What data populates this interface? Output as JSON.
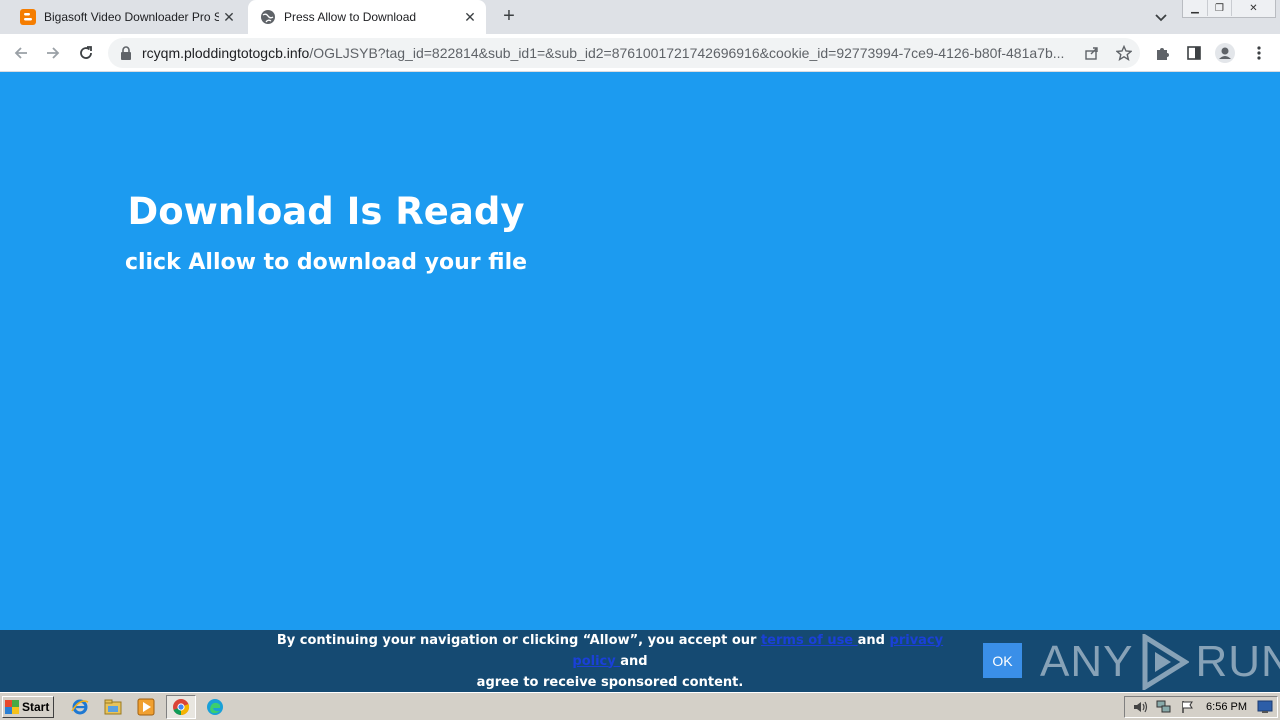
{
  "browser": {
    "tabs": [
      {
        "title": "Bigasoft Video Downloader Pro Serial",
        "favicon": "blogger-icon",
        "active": false
      },
      {
        "title": "Press Allow to Download",
        "favicon": "globe-icon",
        "active": true
      }
    ],
    "new_tab_label": "+",
    "url_host": "rcyqm.ploddingtotogcb.info",
    "url_rest": "/OGLJSYB?tag_id=822814&sub_id1=&sub_id2=8761001721742696916&cookie_id=92773994-7ce9-4126-b80f-481a7b..."
  },
  "page": {
    "headline": "Download Is Ready",
    "subline": "click Allow to download your file",
    "background_color": "#1c9bf0"
  },
  "consent": {
    "line1_prefix": "By continuing your navigation or clicking “Allow”, you accept our ",
    "terms_link": "terms of use ",
    "and_text": "and ",
    "privacy_link": "privacy policy ",
    "line1_suffix": "and",
    "line2": "agree to receive sponsored content.",
    "ok_label": "OK"
  },
  "watermark": {
    "left": "ANY",
    "right": "RUN"
  },
  "taskbar": {
    "start_label": "Start",
    "clock": "6:56 PM"
  }
}
